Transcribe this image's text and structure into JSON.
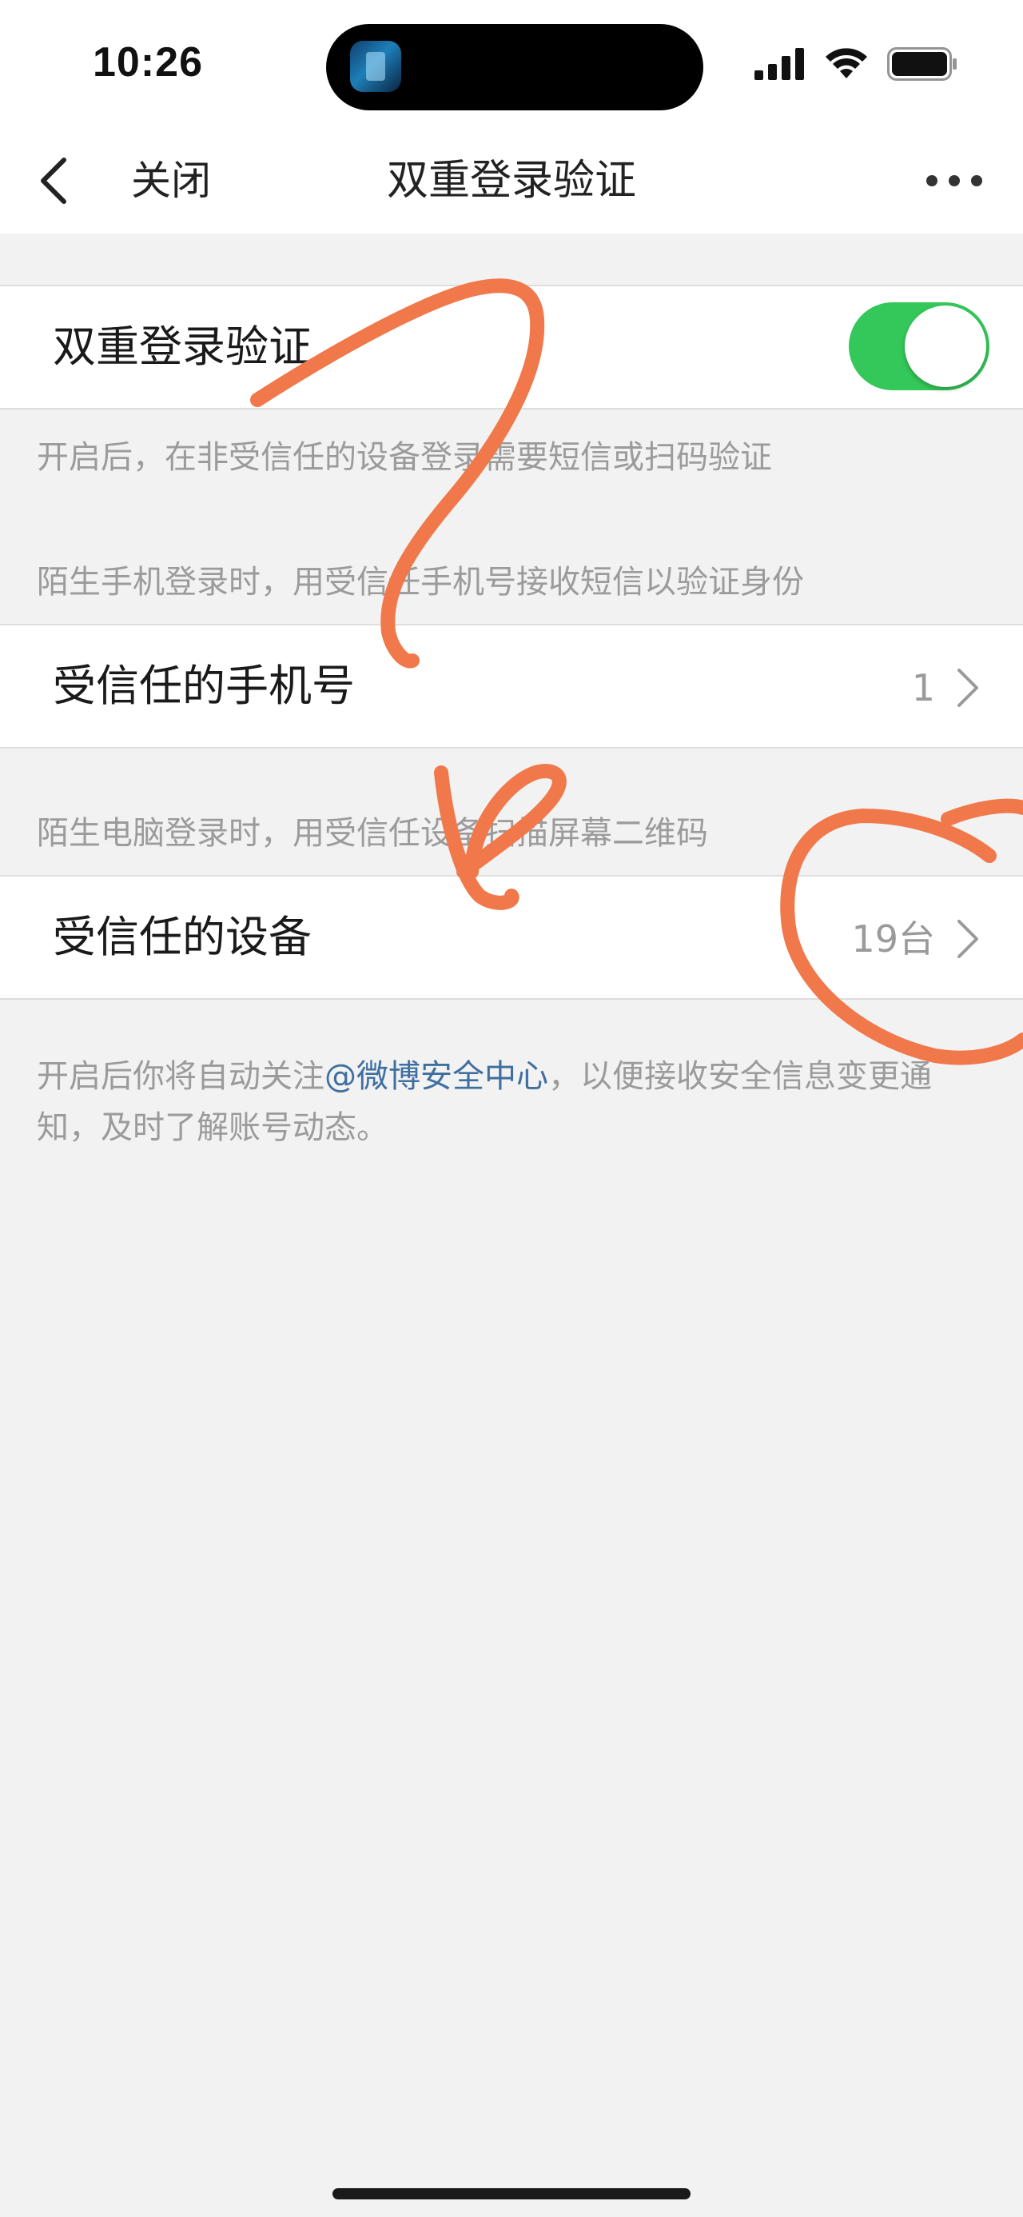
{
  "status_bar": {
    "time": "10:26"
  },
  "nav": {
    "close_label": "关闭",
    "title": "双重登录验证"
  },
  "two_factor": {
    "label": "双重登录验证",
    "enabled": true,
    "hint": "开启后，在非受信任的设备登录需要短信或扫码验证"
  },
  "trusted_phone": {
    "section_hint": "陌生手机登录时，用受信任手机号接收短信以验证身份",
    "label": "受信任的手机号",
    "value": "1"
  },
  "trusted_device": {
    "section_hint": "陌生电脑登录时，用受信任设备扫描屏幕二维码",
    "label": "受信任的设备",
    "value": "19台"
  },
  "footer_note": {
    "before": "开启后你将自动关注",
    "link": "@微博安全中心",
    "after": "，以便接收安全信息变更通知，及时了解账号动态。"
  },
  "colors": {
    "toggle_on": "#34c759",
    "link": "#3f6fa0",
    "annotation": "#f0784a",
    "background": "#f2f2f2"
  },
  "icons": {
    "back": "chevron-left-icon",
    "more": "more-horizontal-icon",
    "cell_arrow": "chevron-right-icon",
    "signal": "cellular-signal-icon",
    "wifi": "wifi-icon",
    "battery": "battery-icon"
  }
}
